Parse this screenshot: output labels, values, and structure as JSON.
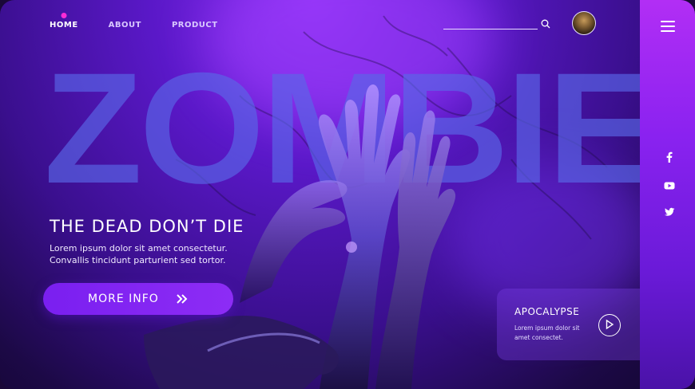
{
  "nav": {
    "items": [
      {
        "label": "HOME",
        "active": true
      },
      {
        "label": "ABOUT",
        "active": false
      },
      {
        "label": "PRODUCT",
        "active": false
      }
    ]
  },
  "search": {
    "icon": "search-icon"
  },
  "sidebar": {
    "menu_icon": "hamburger-icon",
    "social_icons": [
      "facebook-icon",
      "youtube-icon",
      "twitter-icon"
    ]
  },
  "hero": {
    "big_title": "ZOMBIE",
    "headline": "THE DEAD DON’T DIE",
    "description_line1": "Lorem ipsum dolor sit amet consectetur.",
    "description_line2": "Convallis tincidunt parturient sed tortor.",
    "cta_label": "MORE INFO"
  },
  "card": {
    "title": "APOCALYPSE",
    "text_line1": "Lorem ipsum dolor sit",
    "text_line2": "amet consectet."
  },
  "colors": {
    "accent": "#8d2cf5",
    "active_dot": "#ff2bd6",
    "sidebar": "#9a26f2"
  }
}
